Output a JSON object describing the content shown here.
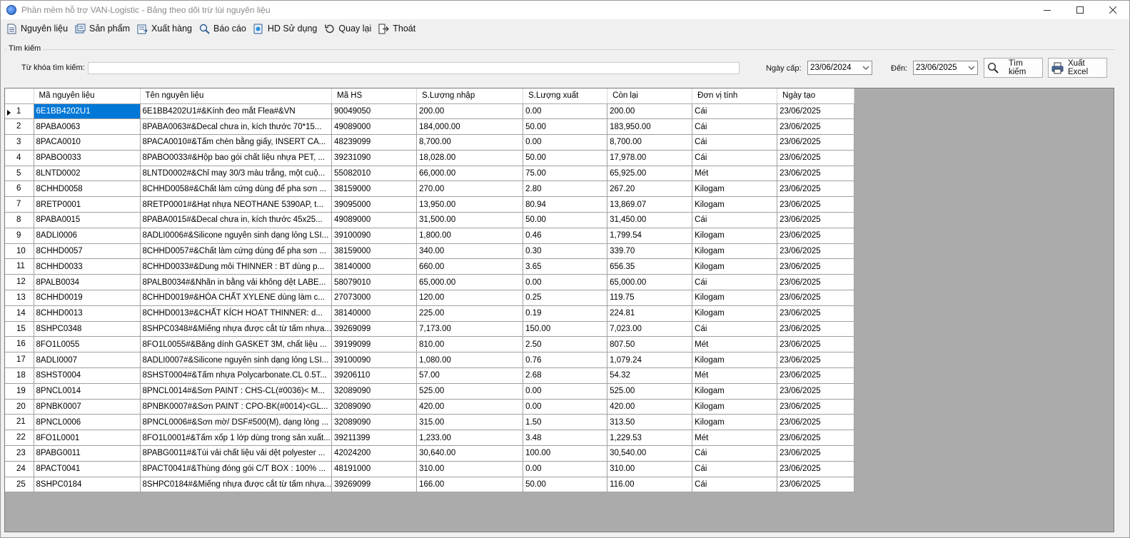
{
  "window": {
    "title": "Phần mềm hỗ trợ VAN-Logistic - Bảng theo dõi trừ lùi nguyên liệu"
  },
  "menu": [
    {
      "label": "Nguyên liệu",
      "icon": "document-icon"
    },
    {
      "label": "Sản phẩm",
      "icon": "product-icon"
    },
    {
      "label": "Xuất hàng",
      "icon": "export-icon"
    },
    {
      "label": "Báo cáo",
      "icon": "report-search-icon"
    },
    {
      "label": "HD Sử dụng",
      "icon": "help-icon"
    },
    {
      "label": "Quay lại",
      "icon": "back-icon"
    },
    {
      "label": "Thoát",
      "icon": "exit-icon"
    }
  ],
  "search": {
    "group_title": "Tìm kiếm",
    "keyword_label": "Từ khóa tìm kiếm:",
    "keyword_value": "",
    "date_from_label": "Ngày cấp:",
    "date_from": "23/06/2024",
    "date_to_label": "Đến:",
    "date_to": "23/06/2025",
    "search_button": "Tìm kiếm",
    "excel_button": "Xuất Excel"
  },
  "grid": {
    "columns": [
      "Mã nguyên liệu",
      "Tên nguyên liệu",
      "Mã HS",
      "S.Lượng nhập",
      "S.Lượng xuất",
      "Còn lại",
      "Đơn vị tính",
      "Ngày tạo"
    ],
    "selected_row": 0,
    "rows": [
      [
        "1",
        "6E1BB4202U1",
        "6E1BB4202U1#&Kính đeo mắt Flea#&VN",
        "90049050",
        "200.00",
        "0.00",
        "200.00",
        "Cái",
        "23/06/2025"
      ],
      [
        "2",
        "8PABA0063",
        "8PABA0063#&Decal chưa in, kích thước 70*15...",
        "49089000",
        "184,000.00",
        "50.00",
        "183,950.00",
        "Cái",
        "23/06/2025"
      ],
      [
        "3",
        "8PACA0010",
        "8PACA0010#&Tấm chèn bằng giấy, INSERT CA...",
        "48239099",
        "8,700.00",
        "0.00",
        "8,700.00",
        "Cái",
        "23/06/2025"
      ],
      [
        "4",
        "8PABO0033",
        "8PABO0033#&Hộp bao gói chất liệu nhựa PET, ...",
        "39231090",
        "18,028.00",
        "50.00",
        "17,978.00",
        "Cái",
        "23/06/2025"
      ],
      [
        "5",
        "8LNTD0002",
        "8LNTD0002#&Chỉ may 30/3 màu trắng, một cuộ...",
        "55082010",
        "66,000.00",
        "75.00",
        "65,925.00",
        "Mét",
        "23/06/2025"
      ],
      [
        "6",
        "8CHHD0058",
        "8CHHD0058#&Chất làm cứng dùng để pha sơn ...",
        "38159000",
        "270.00",
        "2.80",
        "267.20",
        "Kilogam",
        "23/06/2025"
      ],
      [
        "7",
        "8RETP0001",
        "8RETP0001#&Hạt nhựa NEOTHANE 5390AP, t...",
        "39095000",
        "13,950.00",
        "80.94",
        "13,869.07",
        "Kilogam",
        "23/06/2025"
      ],
      [
        "8",
        "8PABA0015",
        "8PABA0015#&Decal chưa in, kích thước 45x25...",
        "49089000",
        "31,500.00",
        "50.00",
        "31,450.00",
        "Cái",
        "23/06/2025"
      ],
      [
        "9",
        "8ADLI0006",
        "8ADLI0006#&Silicone nguyên sinh dạng lỏng LSI...",
        "39100090",
        "1,800.00",
        "0.46",
        "1,799.54",
        "Kilogam",
        "23/06/2025"
      ],
      [
        "10",
        "8CHHD0057",
        "8CHHD0057#&Chất làm cứng dùng để pha sơn ...",
        "38159000",
        "340.00",
        "0.30",
        "339.70",
        "Kilogam",
        "23/06/2025"
      ],
      [
        "11",
        "8CHHD0033",
        "8CHHD0033#&Dung môi THINNER : BT dùng p...",
        "38140000",
        "660.00",
        "3.65",
        "656.35",
        "Kilogam",
        "23/06/2025"
      ],
      [
        "12",
        "8PALB0034",
        "8PALB0034#&Nhãn in bằng vải không dệt LABE...",
        "58079010",
        "65,000.00",
        "0.00",
        "65,000.00",
        "Cái",
        "23/06/2025"
      ],
      [
        "13",
        "8CHHD0019",
        "8CHHD0019#&HÓA CHẤT XYLENE dùng làm c...",
        "27073000",
        "120.00",
        "0.25",
        "119.75",
        "Kilogam",
        "23/06/2025"
      ],
      [
        "14",
        "8CHHD0013",
        "8CHHD0013#&CHẤT KÍCH HOẠT THINNER: d...",
        "38140000",
        "225.00",
        "0.19",
        "224.81",
        "Kilogam",
        "23/06/2025"
      ],
      [
        "15",
        "8SHPC0348",
        "8SHPC0348#&Miếng nhựa được cắt từ tấm nhựa...",
        "39269099",
        "7,173.00",
        "150.00",
        "7,023.00",
        "Cái",
        "23/06/2025"
      ],
      [
        "16",
        "8FO1L0055",
        "8FO1L0055#&Băng dính GASKET 3M, chất liệu ...",
        "39199099",
        "810.00",
        "2.50",
        "807.50",
        "Mét",
        "23/06/2025"
      ],
      [
        "17",
        "8ADLI0007",
        "8ADLI0007#&Silicone nguyên sinh dạng lỏng LSI...",
        "39100090",
        "1,080.00",
        "0.76",
        "1,079.24",
        "Kilogam",
        "23/06/2025"
      ],
      [
        "18",
        "8SHST0004",
        "8SHST0004#&Tấm nhựa Polycarbonate.CL 0.5T...",
        "39206110",
        "57.00",
        "2.68",
        "54.32",
        "Mét",
        "23/06/2025"
      ],
      [
        "19",
        "8PNCL0014",
        "8PNCL0014#&Sơn PAINT : CHS-CL(#0036)< M...",
        "32089090",
        "525.00",
        "0.00",
        "525.00",
        "Kilogam",
        "23/06/2025"
      ],
      [
        "20",
        "8PNBK0007",
        "8PNBK0007#&Sơn PAINT : CPO-BK(#0014)<GL...",
        "32089090",
        "420.00",
        "0.00",
        "420.00",
        "Kilogam",
        "23/06/2025"
      ],
      [
        "21",
        "8PNCL0006",
        "8PNCL0006#&Sơn mờ/ DSF#500(M), dạng lỏng ...",
        "32089090",
        "315.00",
        "1.50",
        "313.50",
        "Kilogam",
        "23/06/2025"
      ],
      [
        "22",
        "8FO1L0001",
        "8FO1L0001#&Tấm xốp 1 lớp dùng trong sản xuất...",
        "39211399",
        "1,233.00",
        "3.48",
        "1,229.53",
        "Mét",
        "23/06/2025"
      ],
      [
        "23",
        "8PABG0011",
        "8PABG0011#&Túi vải chất liệu vải dệt polyester ...",
        "42024200",
        "30,640.00",
        "100.00",
        "30,540.00",
        "Cái",
        "23/06/2025"
      ],
      [
        "24",
        "8PACT0041",
        "8PACT0041#&Thùng đóng gói C/T BOX : 100% ...",
        "48191000",
        "310.00",
        "0.00",
        "310.00",
        "Cái",
        "23/06/2025"
      ],
      [
        "25",
        "8SHPC0184",
        "8SHPC0184#&Miếng nhựa được cắt từ tấm nhựa...",
        "39269099",
        "166.00",
        "50.00",
        "116.00",
        "Cái",
        "23/06/2025"
      ]
    ]
  },
  "colors": {
    "selection": "#0078d7",
    "grid_empty": "#ababab",
    "window_bg": "#f0f0f0"
  }
}
